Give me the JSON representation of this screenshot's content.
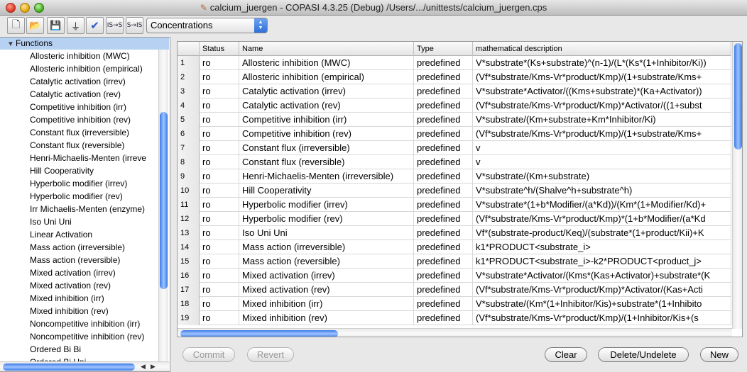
{
  "window": {
    "title": "calcium_juergen - COPASI 4.3.25 (Debug) /Users/.../unittests/calcium_juergen.cps"
  },
  "toolbar": {
    "buttons": [
      {
        "name": "new-file",
        "glyph": "🗋"
      },
      {
        "name": "open-file",
        "glyph": "📂"
      },
      {
        "name": "save-file",
        "glyph": "💾"
      },
      {
        "name": "slider",
        "glyph": "⏚"
      },
      {
        "name": "check",
        "glyph": "✔"
      },
      {
        "name": "is-to-s",
        "glyph": "IS→S"
      },
      {
        "name": "s-to-is",
        "glyph": "S→IS"
      }
    ],
    "mode_select": "Concentrations"
  },
  "tree": {
    "root_label": "Functions",
    "items": [
      "Allosteric inhibition (MWC)",
      "Allosteric inhibition (empirical)",
      "Catalytic activation (irrev)",
      "Catalytic activation (rev)",
      "Competitive inhibition (irr)",
      "Competitive inhibition (rev)",
      "Constant flux (irreversible)",
      "Constant flux (reversible)",
      "Henri-Michaelis-Menten (irreve",
      "Hill Cooperativity",
      "Hyperbolic modifier (irrev)",
      "Hyperbolic modifier (rev)",
      "Irr Michaelis-Menten (enzyme)",
      "Iso Uni Uni",
      "Linear Activation",
      "Mass action (irreversible)",
      "Mass action (reversible)",
      "Mixed activation (irrev)",
      "Mixed activation (rev)",
      "Mixed inhibition (irr)",
      "Mixed inhibition (rev)",
      "Noncompetitive inhibition (irr)",
      "Noncompetitive inhibition (rev)",
      "Ordered Bi Bi",
      "Ordered Bi Uni"
    ]
  },
  "table": {
    "columns": [
      "",
      "Status",
      "Name",
      "Type",
      "mathematical description"
    ],
    "rows": [
      {
        "n": "1",
        "status": "ro",
        "name": "Allosteric inhibition (MWC)",
        "type": "predefined",
        "desc": "V*substrate*(Ks+substrate)^(n-1)/(L*(Ks*(1+Inhibitor/Ki))"
      },
      {
        "n": "2",
        "status": "ro",
        "name": "Allosteric inhibition (empirical)",
        "type": "predefined",
        "desc": "(Vf*substrate/Kms-Vr*product/Kmp)/(1+substrate/Kms+"
      },
      {
        "n": "3",
        "status": "ro",
        "name": "Catalytic activation (irrev)",
        "type": "predefined",
        "desc": "V*substrate*Activator/((Kms+substrate)*(Ka+Activator))"
      },
      {
        "n": "4",
        "status": "ro",
        "name": "Catalytic activation (rev)",
        "type": "predefined",
        "desc": "(Vf*substrate/Kms-Vr*product/Kmp)*Activator/((1+subst"
      },
      {
        "n": "5",
        "status": "ro",
        "name": "Competitive inhibition (irr)",
        "type": "predefined",
        "desc": "V*substrate/(Km+substrate+Km*Inhibitor/Ki)"
      },
      {
        "n": "6",
        "status": "ro",
        "name": "Competitive inhibition (rev)",
        "type": "predefined",
        "desc": "(Vf*substrate/Kms-Vr*product/Kmp)/(1+substrate/Kms+"
      },
      {
        "n": "7",
        "status": "ro",
        "name": "Constant flux (irreversible)",
        "type": "predefined",
        "desc": "v"
      },
      {
        "n": "8",
        "status": "ro",
        "name": "Constant flux (reversible)",
        "type": "predefined",
        "desc": "v"
      },
      {
        "n": "9",
        "status": "ro",
        "name": "Henri-Michaelis-Menten (irreversible)",
        "type": "predefined",
        "desc": "V*substrate/(Km+substrate)"
      },
      {
        "n": "10",
        "status": "ro",
        "name": "Hill Cooperativity",
        "type": "predefined",
        "desc": "V*substrate^h/(Shalve^h+substrate^h)"
      },
      {
        "n": "11",
        "status": "ro",
        "name": "Hyperbolic modifier (irrev)",
        "type": "predefined",
        "desc": "V*substrate*(1+b*Modifier/(a*Kd))/(Km*(1+Modifier/Kd)+"
      },
      {
        "n": "12",
        "status": "ro",
        "name": "Hyperbolic modifier (rev)",
        "type": "predefined",
        "desc": "(Vf*substrate/Kms-Vr*product/Kmp)*(1+b*Modifier/(a*Kd"
      },
      {
        "n": "13",
        "status": "ro",
        "name": "Iso Uni Uni",
        "type": "predefined",
        "desc": "Vf*(substrate-product/Keq)/(substrate*(1+product/Kii)+K"
      },
      {
        "n": "14",
        "status": "ro",
        "name": "Mass action (irreversible)",
        "type": "predefined",
        "desc": "k1*PRODUCT<substrate_i>"
      },
      {
        "n": "15",
        "status": "ro",
        "name": "Mass action (reversible)",
        "type": "predefined",
        "desc": "k1*PRODUCT<substrate_i>-k2*PRODUCT<product_j>"
      },
      {
        "n": "16",
        "status": "ro",
        "name": "Mixed activation (irrev)",
        "type": "predefined",
        "desc": "V*substrate*Activator/(Kms*(Kas+Activator)+substrate*(K"
      },
      {
        "n": "17",
        "status": "ro",
        "name": "Mixed activation (rev)",
        "type": "predefined",
        "desc": "(Vf*substrate/Kms-Vr*product/Kmp)*Activator/(Kas+Acti"
      },
      {
        "n": "18",
        "status": "ro",
        "name": "Mixed inhibition (irr)",
        "type": "predefined",
        "desc": "V*substrate/(Km*(1+Inhibitor/Kis)+substrate*(1+Inhibito"
      },
      {
        "n": "19",
        "status": "ro",
        "name": "Mixed inhibition (rev)",
        "type": "predefined",
        "desc": "(Vf*substrate/Kms-Vr*product/Kmp)/(1+Inhibitor/Kis+(s"
      }
    ]
  },
  "buttons": {
    "commit": "Commit",
    "revert": "Revert",
    "clear": "Clear",
    "delete_undelete": "Delete/Undelete",
    "new": "New"
  }
}
